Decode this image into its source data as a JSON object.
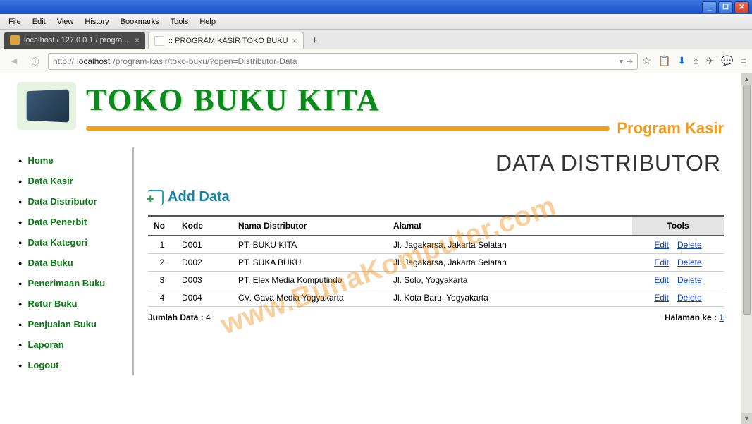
{
  "window": {
    "menus": [
      "File",
      "Edit",
      "View",
      "History",
      "Bookmarks",
      "Tools",
      "Help"
    ]
  },
  "tabs": [
    {
      "label": "localhost / 127.0.0.1 / progra…",
      "active": false
    },
    {
      "label": ":: PROGRAM KASIR TOKO BUKU",
      "active": true
    }
  ],
  "url": {
    "prefix": "http://",
    "host": "localhost",
    "path": "/program-kasir/toko-buku/?open=Distributor-Data"
  },
  "brand": {
    "title": "TOKO BUKU KITA",
    "subtitle": "Program Kasir"
  },
  "sidebar": [
    "Home",
    "Data Kasir",
    "Data Distributor",
    "Data Penerbit",
    "Data Kategori",
    "Data Buku",
    "Penerimaan Buku",
    "Retur Buku",
    "Penjualan Buku",
    "Laporan",
    "Logout"
  ],
  "page": {
    "title": "DATA DISTRIBUTOR",
    "add_label": "Add Data",
    "columns": {
      "no": "No",
      "kode": "Kode",
      "nama": "Nama Distributor",
      "alamat": "Alamat",
      "tools": "Tools"
    },
    "rows": [
      {
        "no": "1",
        "kode": "D001",
        "nama": "PT. BUKU KITA",
        "alamat": "Jl. Jagakarsa, Jakarta Selatan"
      },
      {
        "no": "2",
        "kode": "D002",
        "nama": "PT. SUKA BUKU",
        "alamat": "Jl. Jagakarsa, Jakarta Selatan"
      },
      {
        "no": "3",
        "kode": "D003",
        "nama": "PT. Elex Media Komputindo",
        "alamat": "Jl. Solo, Yogyakarta"
      },
      {
        "no": "4",
        "kode": "D004",
        "nama": "CV. Gava Media Yogyakarta",
        "alamat": "Jl. Kota Baru, Yogyakarta"
      }
    ],
    "edit_label": "Edit",
    "delete_label": "Delete",
    "count_label": "Jumlah Data :",
    "count_value": "4",
    "page_label": "Halaman ke :",
    "page_value": "1"
  },
  "watermark": "www.BunaKomputer.com"
}
